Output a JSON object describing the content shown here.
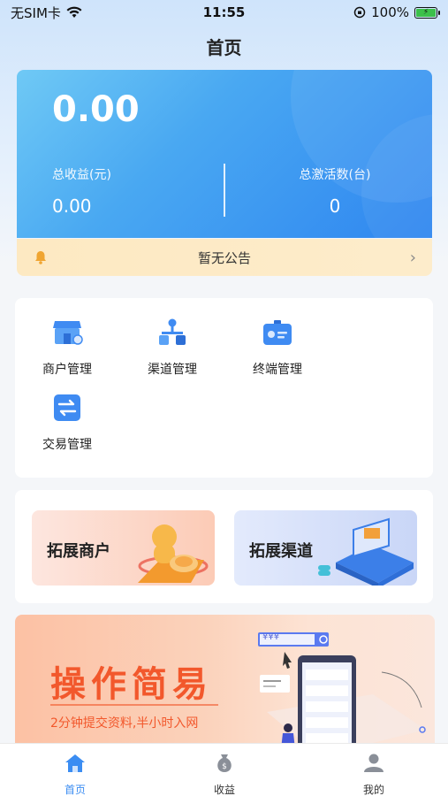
{
  "status_bar": {
    "carrier": "无SIM卡",
    "time": "11:55",
    "battery_pct": "100%"
  },
  "nav": {
    "title": "首页"
  },
  "hero": {
    "main_value": "0.00",
    "total_income_label": "总收益(元)",
    "total_income_value": "0.00",
    "total_activations_label": "总激活数(台)",
    "total_activations_value": "0"
  },
  "notice": {
    "text": "暂无公告",
    "bell_icon": "bell-icon",
    "chevron_icon": "chevron-right-icon"
  },
  "menu": {
    "items": [
      {
        "label": "商户管理",
        "icon": "store-icon"
      },
      {
        "label": "渠道管理",
        "icon": "channel-icon"
      },
      {
        "label": "终端管理",
        "icon": "terminal-card-icon"
      },
      {
        "label": "交易管理",
        "icon": "transaction-icon"
      }
    ]
  },
  "promo": {
    "expand_merchant": "拓展商户",
    "expand_channel": "拓展渠道"
  },
  "banner": {
    "title": "操作简易",
    "subtitle": "2分钟提交资料,半小时入网",
    "search_text": "¥¥¥"
  },
  "tabbar": {
    "items": [
      {
        "label": "首页",
        "icon": "home-icon",
        "active": true
      },
      {
        "label": "收益",
        "icon": "money-bag-icon",
        "active": false
      },
      {
        "label": "我的",
        "icon": "profile-icon",
        "active": false
      }
    ]
  },
  "colors": {
    "accent": "#3b8df2",
    "banner_text": "#f2582c",
    "notice_bg": "#fde9c2"
  }
}
